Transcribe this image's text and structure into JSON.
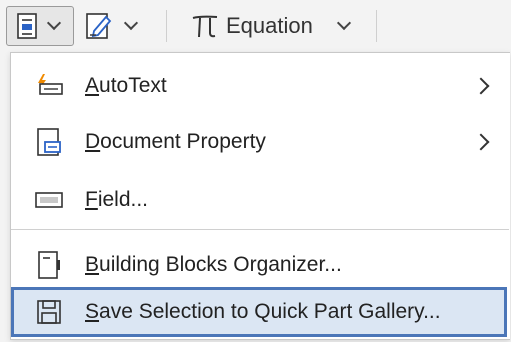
{
  "toolbar": {
    "equation_label": "Equation",
    "icons": [
      "quick-parts-icon",
      "signature-line-icon",
      "pi-icon"
    ]
  },
  "menu": {
    "items": [
      {
        "accel": "A",
        "rest": "utoText",
        "has_submenu": true,
        "icon": "autotext-icon"
      },
      {
        "accel": "D",
        "rest": "ocument Property",
        "has_submenu": true,
        "icon": "document-property-icon"
      },
      {
        "accel": "F",
        "rest": "ield...",
        "has_submenu": false,
        "icon": "field-icon"
      },
      {
        "accel": "B",
        "rest": "uilding Blocks Organizer...",
        "has_submenu": false,
        "icon": "building-blocks-icon"
      },
      {
        "accel": "S",
        "rest": "ave Selection to Quick Part Gallery...",
        "has_submenu": false,
        "icon": "save-icon",
        "highlighted": true
      }
    ]
  },
  "colors": {
    "highlight_bg": "#dbe6f3",
    "highlight_border": "#4b76b8",
    "accent_blue": "#2b63c6",
    "autotext_orange": "#f08a00"
  }
}
